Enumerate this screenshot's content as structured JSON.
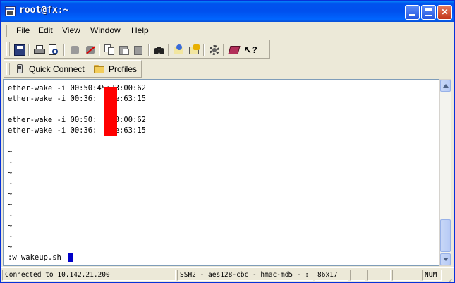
{
  "window": {
    "title": "root@fx:~"
  },
  "menu": [
    {
      "label": "File"
    },
    {
      "label": "Edit"
    },
    {
      "label": "View"
    },
    {
      "label": "Window"
    },
    {
      "label": "Help"
    }
  ],
  "toolbar": {
    "icons": [
      "save-icon",
      "print-icon",
      "print-preview-icon",
      "connect-icon",
      "disconnect-icon",
      "copy-icon",
      "paste-icon",
      "clipboard-icon",
      "find-icon",
      "settings-icon",
      "settings2-icon",
      "gear-icon",
      "book-icon",
      "help-pointer-icon"
    ]
  },
  "quickbar": {
    "quick_connect": "Quick Connect",
    "profiles": "Profiles"
  },
  "terminal": {
    "lines": [
      "ether-wake -i 00:50:45:33:00:62",
      "ether-wake -i 00:36:  :fe:63:15",
      "",
      "ether-wake -i 00:50:  :33:00:62",
      "ether-wake -i 00:36:  :fe:63:15",
      "",
      "~",
      "~",
      "~",
      "~",
      "~",
      "~",
      "~",
      "~",
      "~",
      "~",
      "",
      ":w wakeup.sh"
    ]
  },
  "status": {
    "connection": "Connected to 10.142.21.200",
    "cipher": "SSH2 - aes128-cbc - hmac-md5 - :",
    "size": "86x17",
    "num": "NUM"
  },
  "colors": {
    "titlebar": "#0053ee",
    "redaction": "#ff0000",
    "cursor": "#0000c8"
  }
}
